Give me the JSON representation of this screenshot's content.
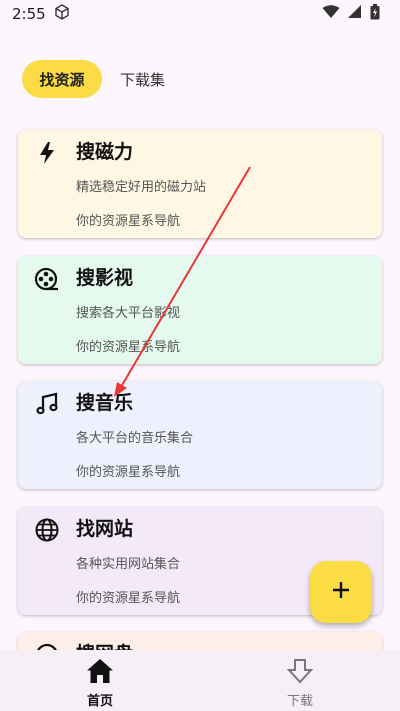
{
  "status_bar": {
    "time": "2:55"
  },
  "tabs": [
    {
      "label": "找资源",
      "active": true
    },
    {
      "label": "下载集",
      "active": false
    }
  ],
  "cards": [
    {
      "icon": "lightning-icon",
      "title": "搜磁力",
      "desc": "精选稳定好用的磁力站",
      "sub": "你的资源星系导航",
      "color": "#fff7e3"
    },
    {
      "icon": "film-reel-icon",
      "title": "搜影视",
      "desc": "搜索各大平台影视",
      "sub": "你的资源星系导航",
      "color": "#e5faee"
    },
    {
      "icon": "music-note-icon",
      "title": "搜音乐",
      "desc": "各大平台的音乐集合",
      "sub": "你的资源星系导航",
      "color": "#eef1fd"
    },
    {
      "icon": "globe-icon",
      "title": "找网站",
      "desc": "各种实用网站集合",
      "sub": "你的资源星系导航",
      "color": "#f4e9f8"
    },
    {
      "icon": "disk-icon",
      "title": "搜网盘",
      "color": "#fdeee8"
    }
  ],
  "fab": {
    "icon": "plus-icon"
  },
  "bottom_nav": [
    {
      "label": "首页",
      "icon": "home-icon",
      "active": true
    },
    {
      "label": "下载",
      "icon": "download-arrow-icon",
      "active": false
    }
  ],
  "colors": {
    "accent": "#fbdc45",
    "annotation_arrow": "#e53935"
  }
}
